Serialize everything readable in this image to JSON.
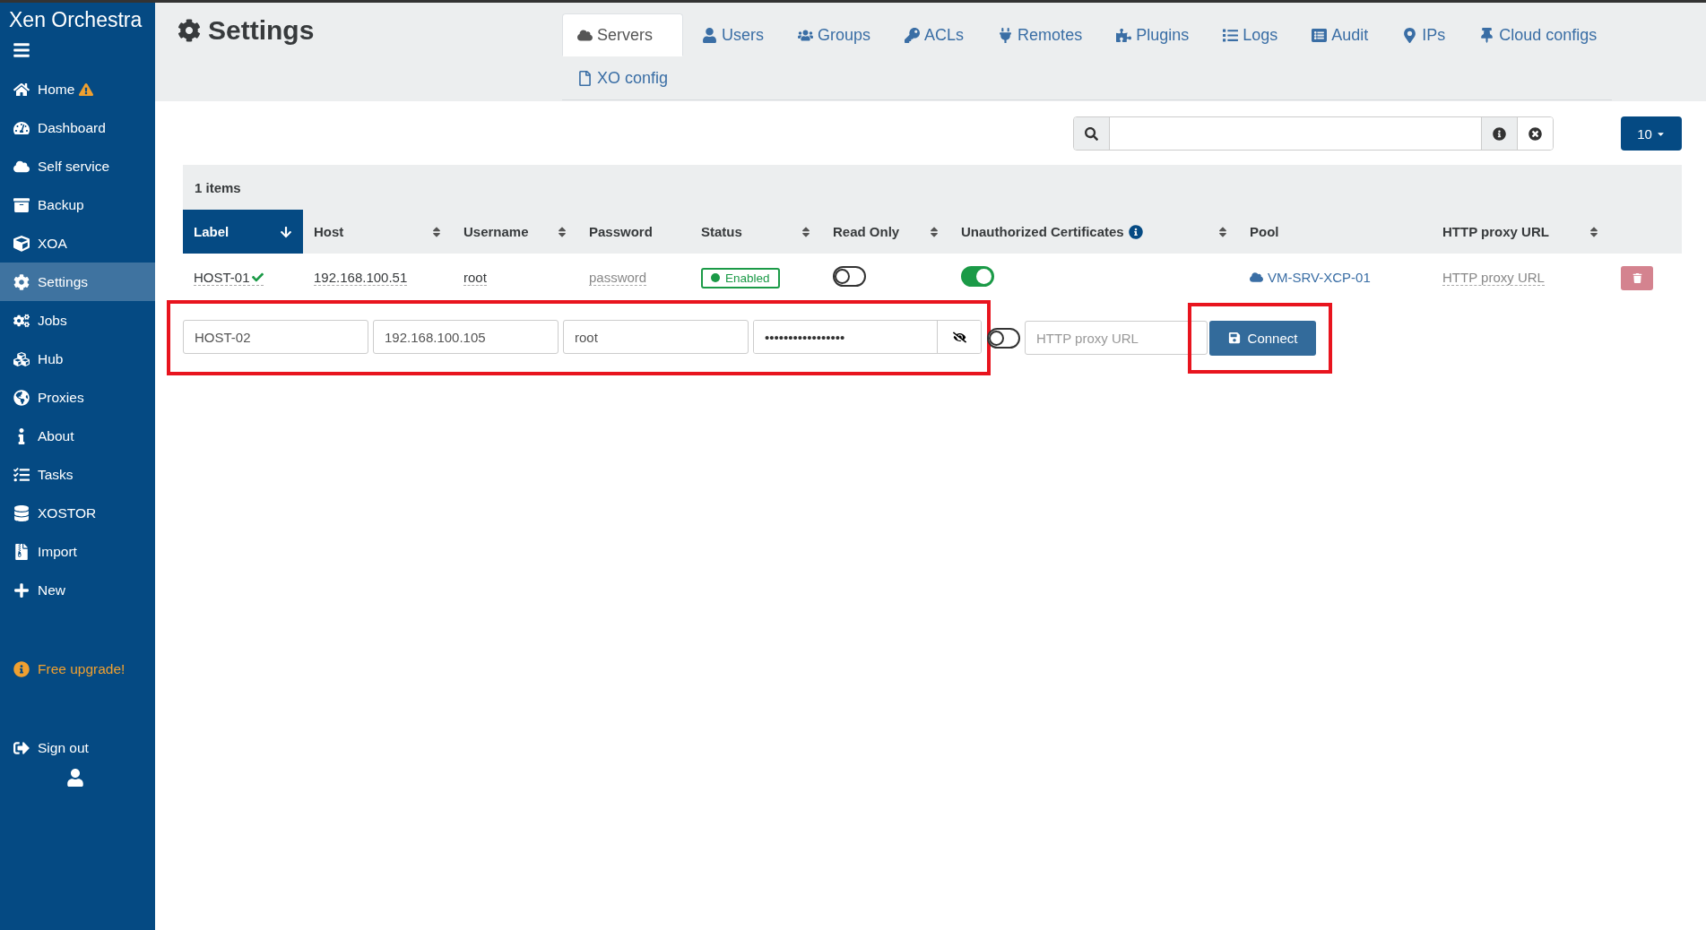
{
  "sidebar": {
    "title": "Xen Orchestra",
    "items": [
      {
        "label": "Home",
        "warning": true,
        "selected": false
      },
      {
        "label": "Dashboard",
        "warning": false,
        "selected": false
      },
      {
        "label": "Self service",
        "warning": false,
        "selected": false
      },
      {
        "label": "Backup",
        "warning": false,
        "selected": false
      },
      {
        "label": "XOA",
        "warning": false,
        "selected": false
      },
      {
        "label": "Settings",
        "warning": false,
        "selected": true
      },
      {
        "label": "Jobs",
        "warning": false,
        "selected": false
      },
      {
        "label": "Hub",
        "warning": false,
        "selected": false
      },
      {
        "label": "Proxies",
        "warning": false,
        "selected": false
      },
      {
        "label": "About",
        "warning": false,
        "selected": false
      },
      {
        "label": "Tasks",
        "warning": false,
        "selected": false
      },
      {
        "label": "XOSTOR",
        "warning": false,
        "selected": false
      },
      {
        "label": "Import",
        "warning": false,
        "selected": false
      },
      {
        "label": "New",
        "warning": false,
        "selected": false
      }
    ],
    "upgrade": "Free upgrade!",
    "sign_out": "Sign out"
  },
  "page": {
    "title": "Settings"
  },
  "tabs": [
    {
      "label": "Servers",
      "selected": true
    },
    {
      "label": "Users",
      "selected": false
    },
    {
      "label": "Groups",
      "selected": false
    },
    {
      "label": "ACLs",
      "selected": false
    },
    {
      "label": "Remotes",
      "selected": false
    },
    {
      "label": "Plugins",
      "selected": false
    },
    {
      "label": "Logs",
      "selected": false
    },
    {
      "label": "Audit",
      "selected": false
    },
    {
      "label": "IPs",
      "selected": false
    },
    {
      "label": "Cloud configs",
      "selected": false
    },
    {
      "label": "XO config",
      "selected": false
    }
  ],
  "page_size": "10",
  "table": {
    "count": "1 items",
    "columns": [
      {
        "label": "Label",
        "selected": true,
        "sortable": true,
        "info": false
      },
      {
        "label": "Host",
        "selected": false,
        "sortable": true,
        "info": false
      },
      {
        "label": "Username",
        "selected": false,
        "sortable": true,
        "info": false
      },
      {
        "label": "Password",
        "selected": false,
        "sortable": false,
        "info": false
      },
      {
        "label": "Status",
        "selected": false,
        "sortable": true,
        "info": false
      },
      {
        "label": "Read Only",
        "selected": false,
        "sortable": true,
        "info": false
      },
      {
        "label": "Unauthorized Certificates",
        "selected": false,
        "sortable": true,
        "info": true
      },
      {
        "label": "Pool",
        "selected": false,
        "sortable": false,
        "info": false
      },
      {
        "label": "HTTP proxy URL",
        "selected": false,
        "sortable": true,
        "info": false
      }
    ],
    "rows": [
      {
        "label": "HOST-01",
        "connected": true,
        "host": "192.168.100.51",
        "username": "root",
        "password": "password",
        "status": "Enabled",
        "enabled": true,
        "read_only": false,
        "unauthorized_certificates": true,
        "pool": "VM-SRV-XCP-01",
        "http_proxy_url": "HTTP proxy URL"
      }
    ]
  },
  "new_server": {
    "label": "HOST-02",
    "host": "192.168.100.105",
    "username": "root",
    "password": "•••••••••••••••••",
    "read_only": false,
    "http_proxy_placeholder": "HTTP proxy URL",
    "button": "Connect"
  }
}
